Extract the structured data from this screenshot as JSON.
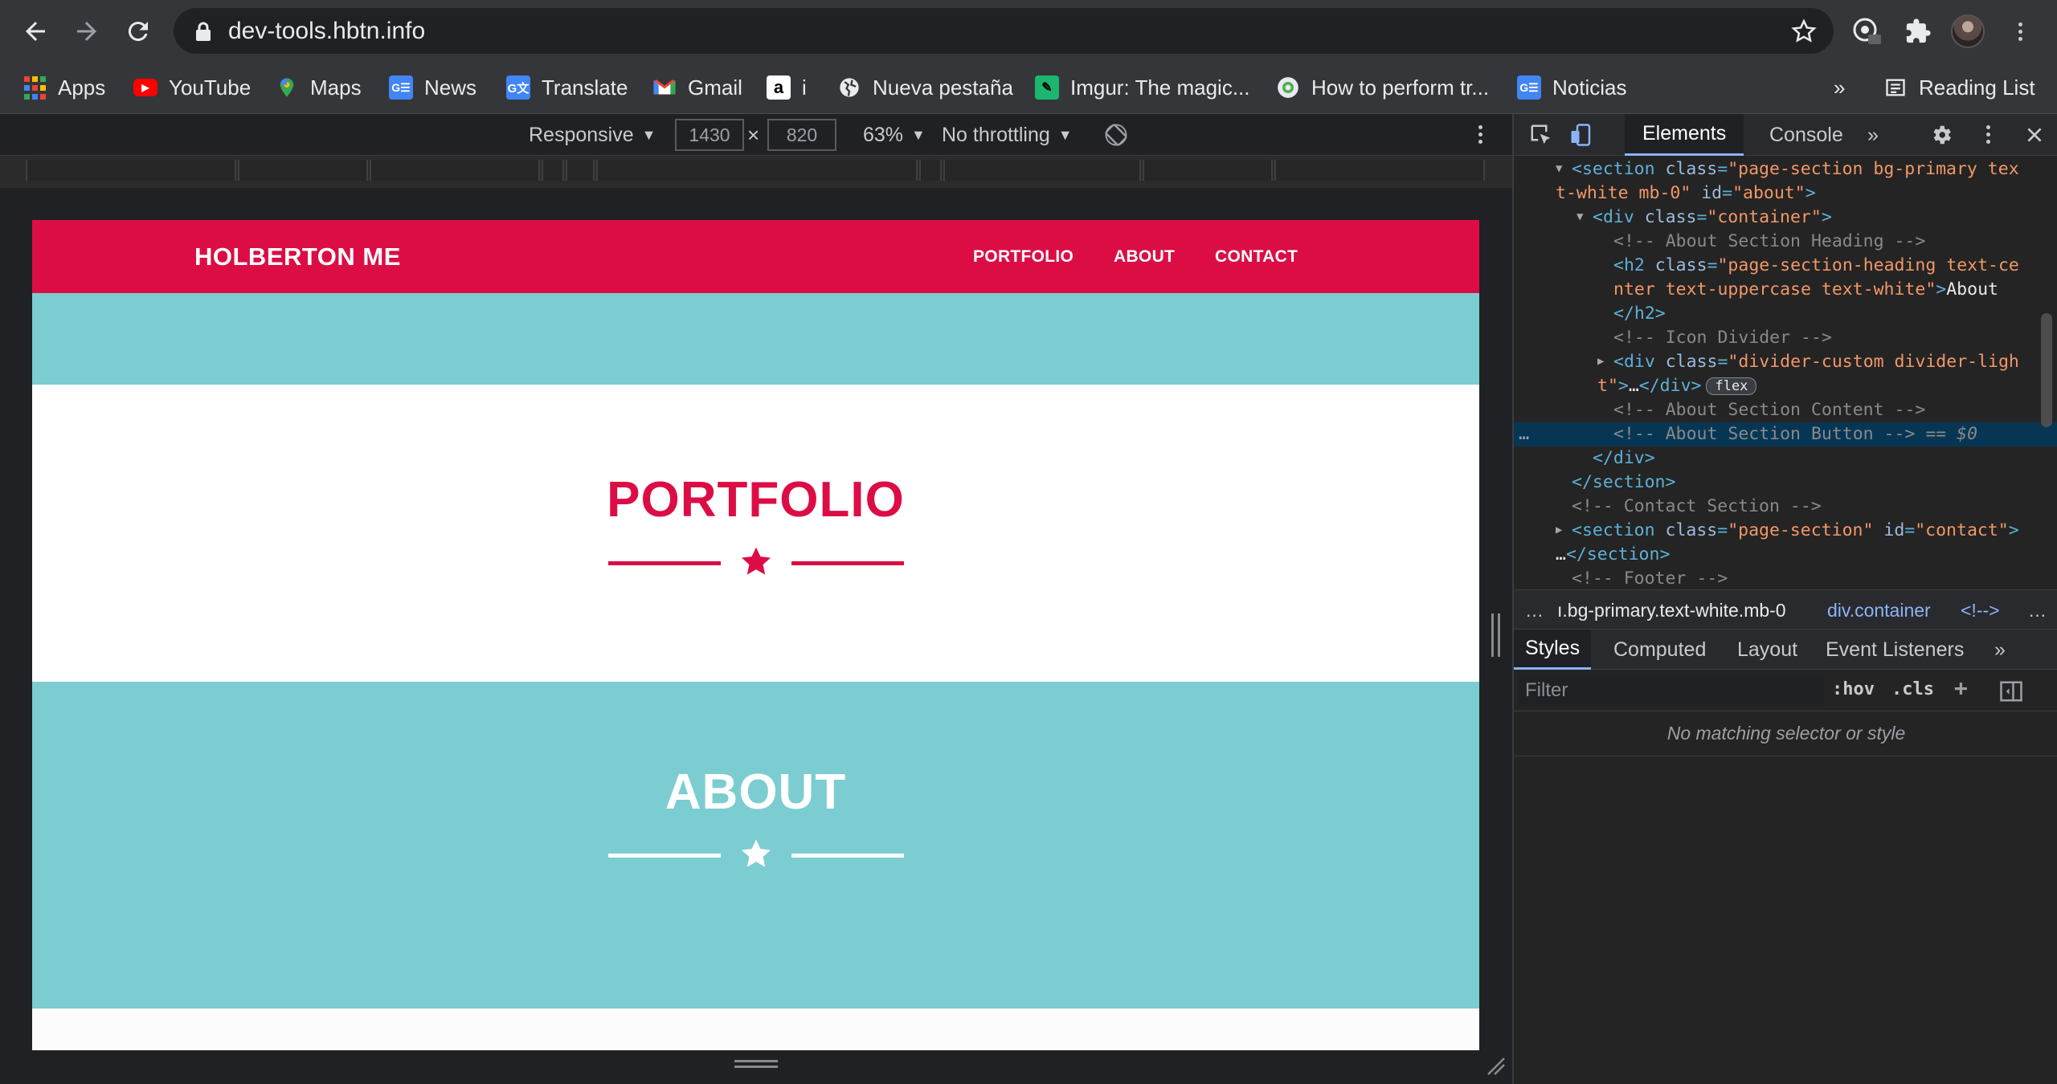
{
  "browser": {
    "url": "dev-tools.hbtn.info",
    "bookmarks": [
      {
        "label": "Apps",
        "icon": "apps-grid-icon"
      },
      {
        "label": "YouTube",
        "icon": "youtube-icon"
      },
      {
        "label": "Maps",
        "icon": "maps-pin-icon"
      },
      {
        "label": "News",
        "icon": "google-news-icon"
      },
      {
        "label": "Translate",
        "icon": "google-translate-icon"
      },
      {
        "label": "Gmail",
        "icon": "gmail-icon"
      },
      {
        "label": "i",
        "icon": "amazon-icon"
      },
      {
        "label": "Nueva pestaña",
        "icon": "globe-icon"
      },
      {
        "label": "Imgur: The magic...",
        "icon": "imgur-icon"
      },
      {
        "label": "How to perform tr...",
        "icon": "circle-favicon-icon"
      },
      {
        "label": "Noticias",
        "icon": "google-news-icon"
      }
    ],
    "overflow_label": "»",
    "reading_list_label": "Reading List"
  },
  "device_toolbar": {
    "mode": "Responsive",
    "width": "1430",
    "height": "820",
    "times": "×",
    "zoom": "63%",
    "throttling": "No throttling"
  },
  "site": {
    "brand": "HOLBERTON ME",
    "nav": [
      "PORTFOLIO",
      "ABOUT",
      "CONTACT"
    ],
    "sections": [
      "PORTFOLIO",
      "ABOUT"
    ],
    "colors": {
      "primary": "#dc0d45",
      "secondary": "#7ccdd1",
      "white": "#ffffff"
    }
  },
  "devtools": {
    "tabs": [
      "Elements",
      "Console"
    ],
    "more": "»",
    "breadcrumbs": [
      "…",
      "ı.bg-primary.text-white.mb-0",
      "div.container",
      "<!-->",
      "…"
    ],
    "subtabs": [
      "Styles",
      "Computed",
      "Layout",
      "Event Listeners",
      "»"
    ],
    "filter_placeholder": "Filter",
    "hov": ":hov",
    "cls": ".cls",
    "plus": "+",
    "no_match": "No matching selector or style",
    "flex_badge": "flex",
    "dots": "…",
    "selected_suffix": "== $0"
  }
}
